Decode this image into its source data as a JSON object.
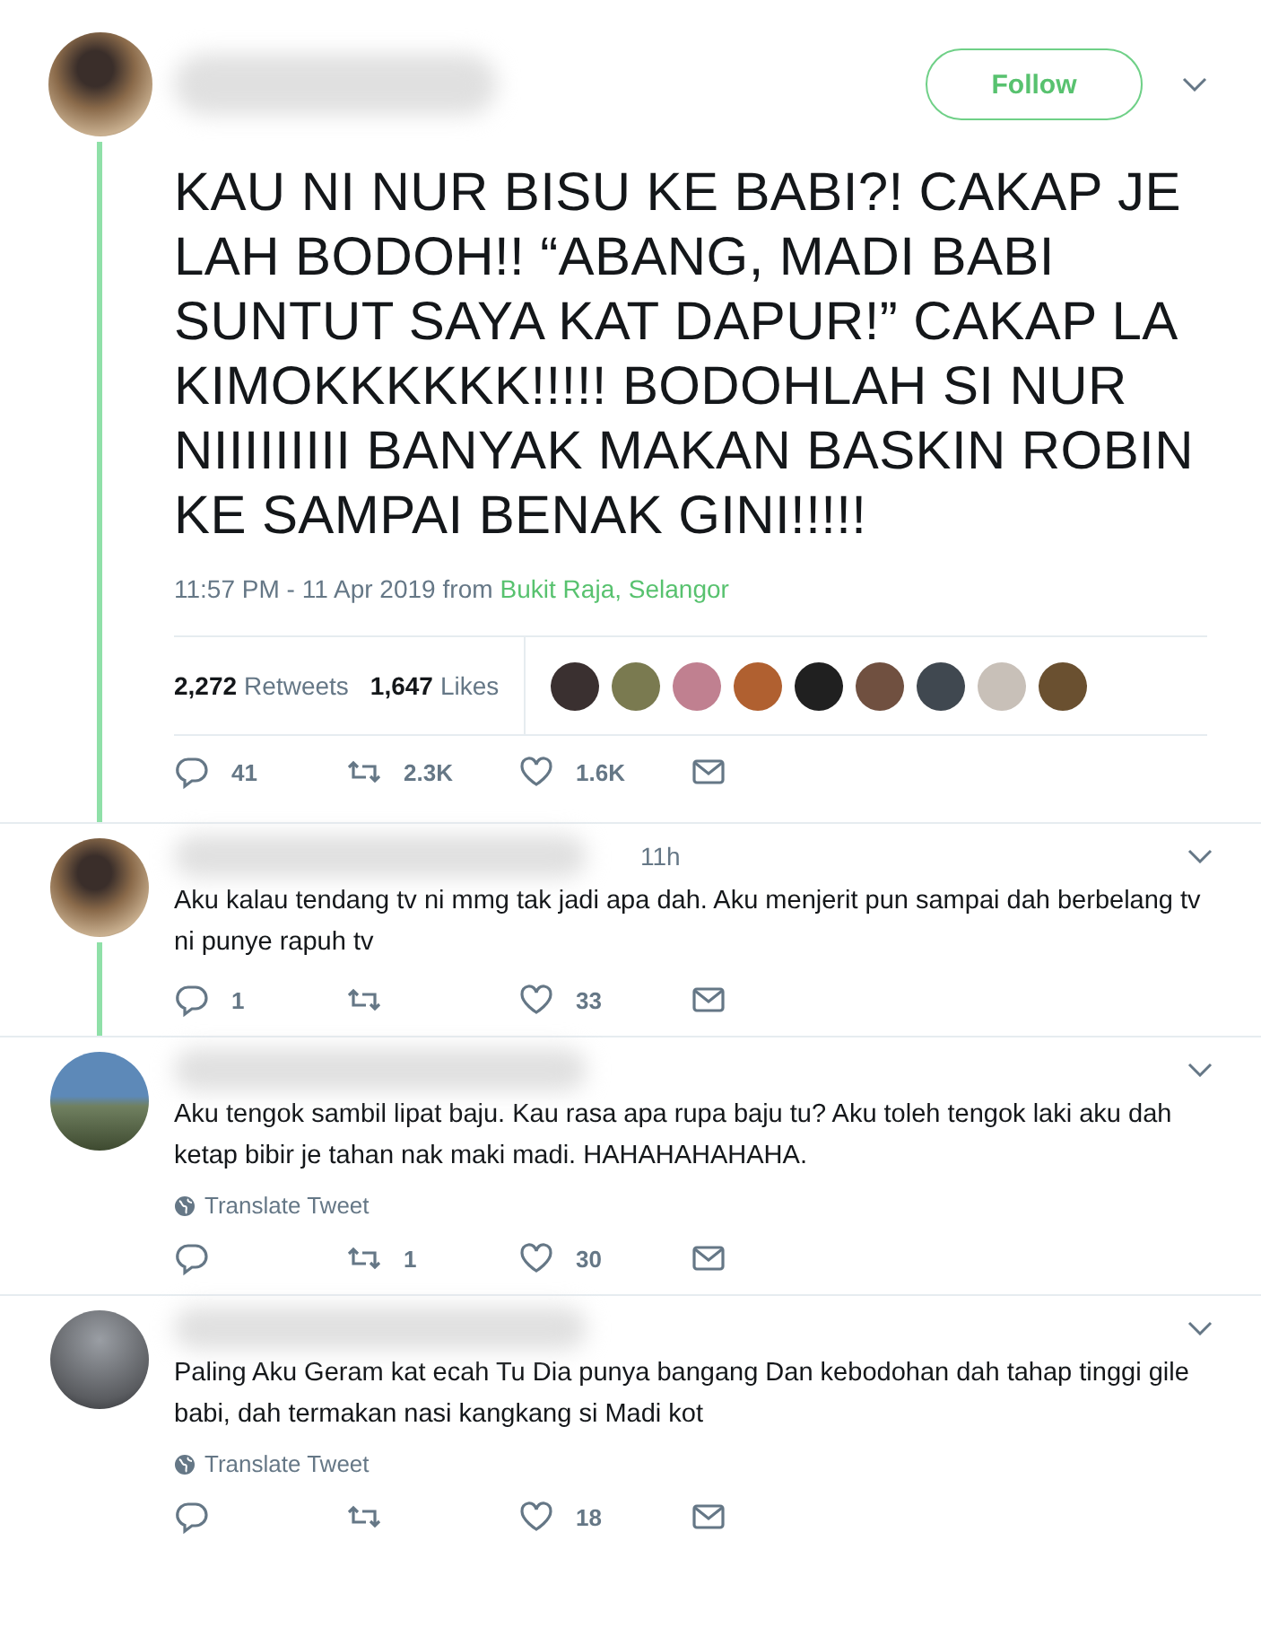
{
  "tweet": {
    "follow_label": "Follow",
    "text": "KAU NI NUR BISU KE BABI?! CAKAP JE LAH BODOH!! “ABANG, MADI BABI SUNTUT SAYA KAT DAPUR!” CAKAP LA KIMOKKKKKK!!!!! BODOHLAH SI NUR NIIIIIIIII BANYAK MAKAN BASKIN ROBIN KE SAMPAI BENAK GINI!!!!!",
    "time": "11:57 PM - 11 Apr 2019",
    "from": "from",
    "place": "Bukit Raja, Selangor",
    "retweets": "2,272",
    "retweets_label": "Retweets",
    "likes": "1,647",
    "likes_label": "Likes",
    "actions": {
      "replies": "41",
      "retweets": "2.3K",
      "likes": "1.6K"
    }
  },
  "replies": [
    {
      "time": "11h",
      "thread": true,
      "text": "Aku kalau tendang tv ni mmg tak jadi apa dah. Aku menjerit pun sampai dah berbelang tv ni punye rapuh tv",
      "actions": {
        "replies": "1",
        "likes": "33"
      }
    },
    {
      "thread": false,
      "text": "Aku tengok sambil lipat baju. Kau rasa apa rupa baju tu? Aku toleh tengok laki aku dah ketap bibir je tahan nak maki madi. HAHAHAHAHAHA.",
      "translate": "Translate Tweet",
      "actions": {
        "retweets": "1",
        "likes": "30"
      }
    },
    {
      "thread": false,
      "text": "Paling Aku Geram kat ecah Tu Dia punya bangang Dan kebodohan dah tahap tinggi gile babi, dah termakan nasi kangkang si Madi kot",
      "translate": "Translate Tweet",
      "actions": {
        "likes": "18"
      }
    }
  ]
}
